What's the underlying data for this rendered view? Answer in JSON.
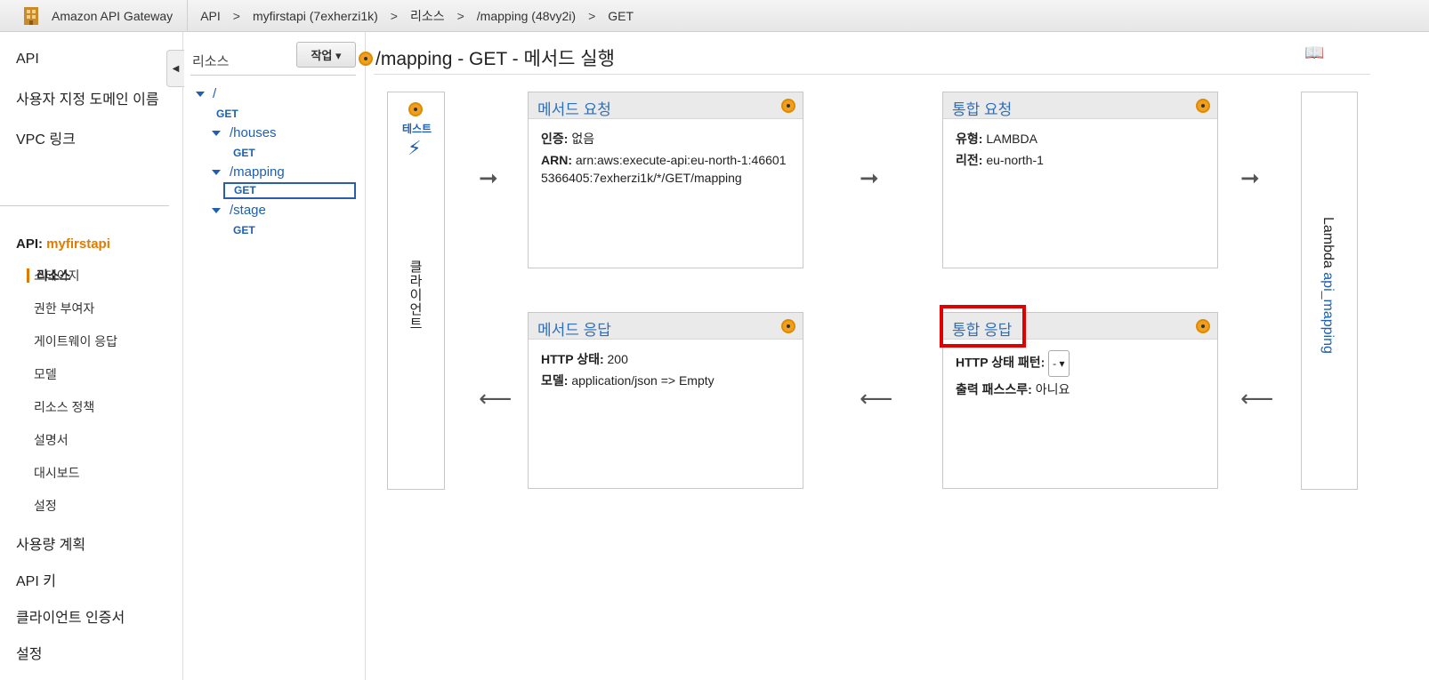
{
  "topbar": {
    "brand": "Amazon API Gateway",
    "crumbs": [
      "API",
      "myfirstapi (7exherzi1k)",
      "리소스",
      "/mapping (48vy2i)",
      "GET"
    ],
    "separator": ">"
  },
  "leftnav": {
    "top_items": [
      "API",
      "사용자 지정 도메인 이름",
      "VPC 링크"
    ],
    "api_label": "API:",
    "api_name": "myfirstapi",
    "active_sub": "리소스",
    "sub_items": [
      "스테이지",
      "권한 부여자",
      "게이트웨이 응답",
      "모델",
      "리소스 정책",
      "설명서",
      "대시보드",
      "설정"
    ],
    "bottom_items": [
      "사용량 계획",
      "API 키",
      "클라이언트 인증서",
      "설정"
    ]
  },
  "tree": {
    "title": "리소스",
    "actions_label": "작업 ▾",
    "root": "/",
    "get": "GET",
    "paths": [
      "/houses",
      "/mapping",
      "/stage"
    ]
  },
  "main": {
    "title": "/mapping - GET - 메서드 실행",
    "client": {
      "test_label": "테스트",
      "label": "클라이언트"
    },
    "lambda": {
      "prefix": "Lambda",
      "function": "api_mapping"
    },
    "method_request": {
      "title": "메서드 요청",
      "auth_label": "인증:",
      "auth_value": "없음",
      "arn_label": "ARN:",
      "arn_value": "arn:aws:execute-api:eu-north-1:466015366405:7exherzi1k/*/GET/mapping"
    },
    "integration_request": {
      "title": "통합 요청",
      "type_label": "유형:",
      "type_value": "LAMBDA",
      "region_label": "리전:",
      "region_value": "eu-north-1"
    },
    "method_response": {
      "title": "메서드 응답",
      "status_label": "HTTP 상태:",
      "status_value": "200",
      "model_label": "모델:",
      "model_value": "application/json => Empty"
    },
    "integration_response": {
      "title": "통합 응답",
      "pattern_label": "HTTP 상태 패턴:",
      "pattern_value": "-",
      "passthrough_label": "출력 패스스루:",
      "passthrough_value": "아니요"
    }
  },
  "colors": {
    "accent": "#e07b00",
    "link": "#1f5fb0",
    "highlight": "#e00000"
  },
  "icons": [
    "amazon-api-gateway-logo",
    "collapse-icon",
    "book-icon",
    "lightning-icon",
    "info-dot-icon",
    "arrow-right-icon",
    "arrow-left-icon"
  ]
}
